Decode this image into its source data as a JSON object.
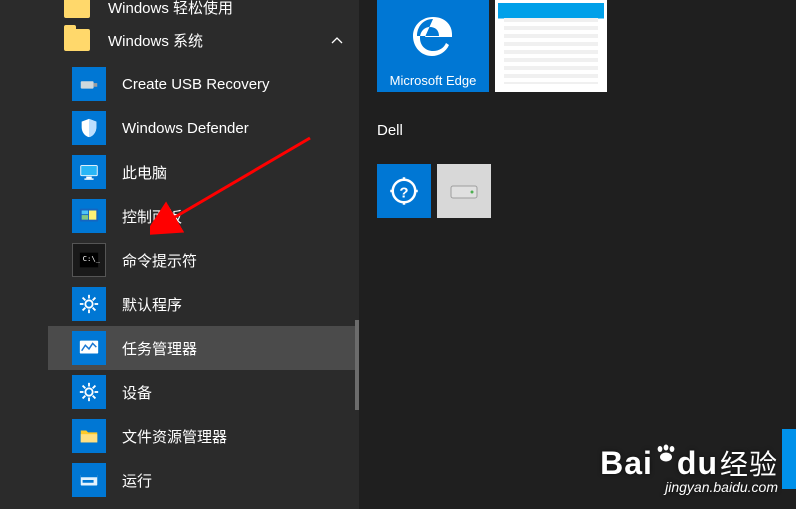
{
  "start_menu": {
    "folder_partial_label": "Windows 轻松使用",
    "folder_label": "Windows 系统",
    "items": [
      {
        "label": "Create USB Recovery"
      },
      {
        "label": "Windows Defender"
      },
      {
        "label": "此电脑"
      },
      {
        "label": "控制面板"
      },
      {
        "label": "命令提示符"
      },
      {
        "label": "默认程序"
      },
      {
        "label": "任务管理器"
      },
      {
        "label": "设备"
      },
      {
        "label": "文件资源管理器"
      },
      {
        "label": "运行"
      }
    ]
  },
  "tiles": {
    "edge_label": "Microsoft Edge",
    "group2_label": "Dell"
  },
  "watermark": {
    "brand_en": "Bai",
    "brand_du": "du",
    "brand_cn": "经验",
    "url": "jingyan.baidu.com"
  }
}
